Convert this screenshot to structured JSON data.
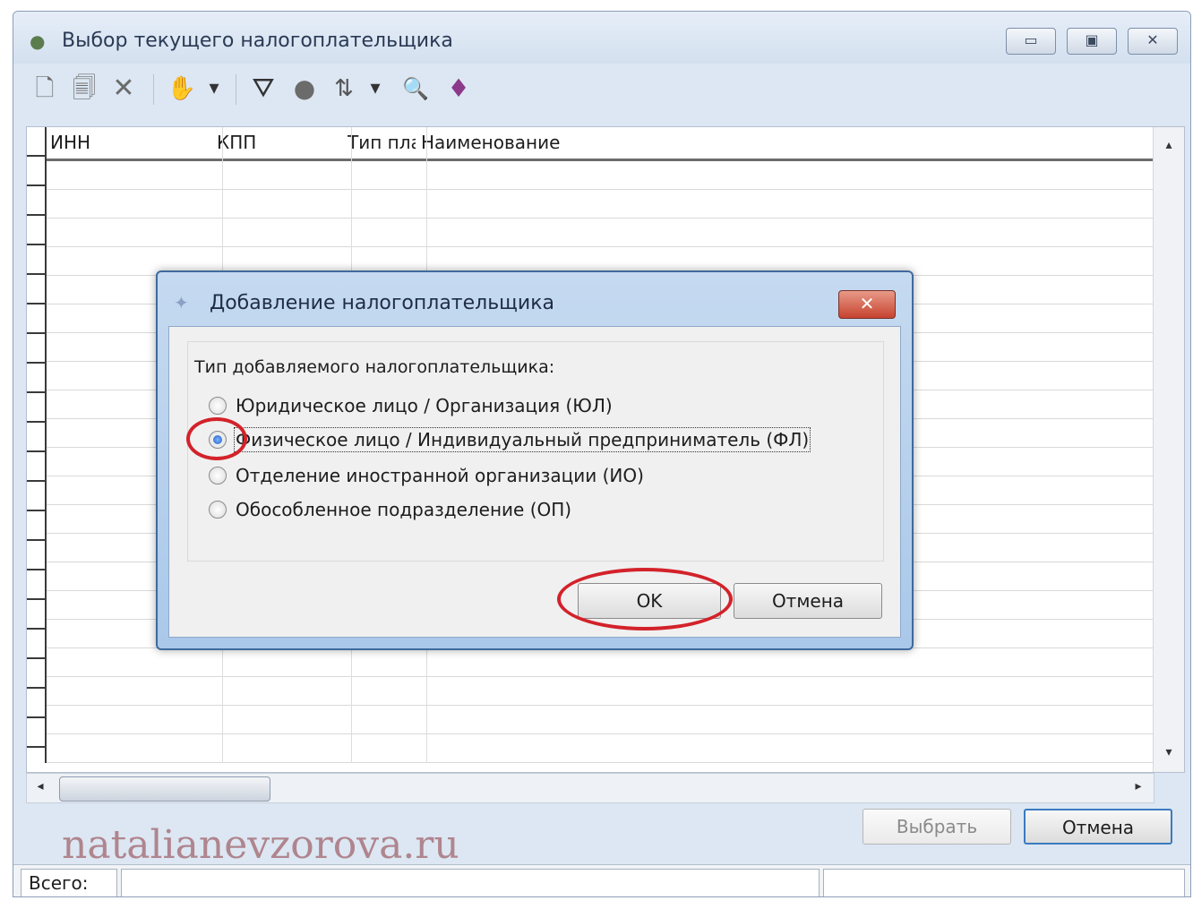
{
  "window": {
    "title": "Выбор текущего налогоплательщика",
    "controls": {
      "minimize": "▭",
      "maximize": "▣",
      "close": "✕"
    }
  },
  "toolbar": {
    "icons": [
      "add-doc-icon",
      "edit-doc-icon",
      "delete-icon",
      "hand-icon",
      "dropdown-arrow-icon",
      "filter-icon",
      "filter-apply-icon",
      "sort-icon",
      "dropdown-arrow-icon",
      "binoculars-icon",
      "help-book-icon"
    ],
    "glyphs": {
      "add": "🗋",
      "edit": "🗐",
      "delete": "✕",
      "hand": "✋",
      "dropdown": "▾",
      "filter": "⛛",
      "filter_apply": "●",
      "sort": "⇅",
      "find": "🔍",
      "help": "♦"
    }
  },
  "grid": {
    "columns": [
      "ИНН",
      "КПП",
      "Тип пла",
      "Наименование"
    ],
    "scroll_up": "▴",
    "scroll_down": "▾",
    "scroll_left": "◂",
    "scroll_right": "▸"
  },
  "dialog": {
    "title": "Добавление налогоплательщика",
    "close": "✕",
    "group_label": "Тип добавляемого налогоплательщика:",
    "options": [
      {
        "label": "Юридическое лицо / Организация (ЮЛ)",
        "checked": false
      },
      {
        "label": "Физическое лицо / Индивидуальный предприниматель (ФЛ)",
        "checked": true
      },
      {
        "label": "Отделение иностранной организации (ИО)",
        "checked": false
      },
      {
        "label": "Обособленное подразделение (ОП)",
        "checked": false
      }
    ],
    "ok_label": "OK",
    "cancel_label": "Отмена"
  },
  "footer": {
    "watermark": "natalianevzorova.ru",
    "select_label": "Выбрать",
    "cancel_label": "Отмена"
  },
  "statusbar": {
    "total_label": "Всего:"
  },
  "colors": {
    "highlight_circle": "#d3222a",
    "default_button_border": "#3b7bbf"
  }
}
